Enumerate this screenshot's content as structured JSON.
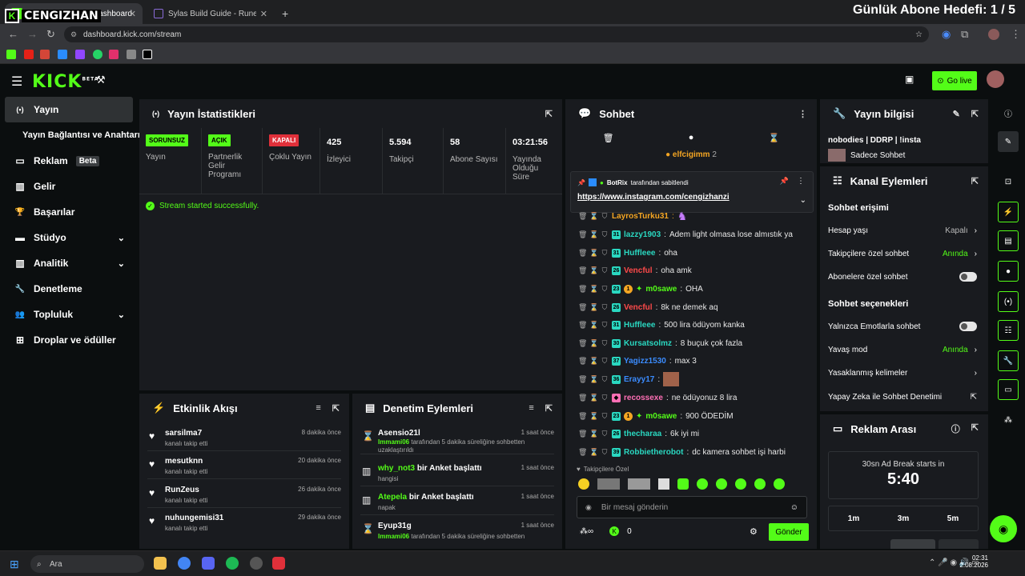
{
  "browser": {
    "tabs": [
      {
        "label": "Dashboard",
        "active": true
      },
      {
        "label": "Sylas Build Guide - Runes, Items",
        "active": false
      }
    ],
    "new_tab": "+",
    "url": "dashboard.kick.com/stream"
  },
  "overlay": {
    "logo_letter": "K",
    "channel_name": "CENGIZHAN",
    "goal_text": "Günlük Abone Hedefi: 1 / 5"
  },
  "header": {
    "logo": "KICK",
    "logo_sup": "BETA",
    "go_live_label": "Go live"
  },
  "sidebar": {
    "items": [
      {
        "label": "Yayın",
        "icon": "broadcast-icon",
        "glyph": "(•)",
        "active": true
      },
      {
        "label": "Yayın Bağlantısı ve Anahtarı",
        "icon": "",
        "glyph": ""
      },
      {
        "label": "Reklam",
        "icon": "monitor-icon",
        "glyph": "▭",
        "badge": "Beta"
      },
      {
        "label": "Gelir",
        "icon": "chart-icon",
        "glyph": "▥"
      },
      {
        "label": "Başarılar",
        "icon": "trophy-icon",
        "glyph": "🏆"
      },
      {
        "label": "Stüdyo",
        "icon": "studio-icon",
        "glyph": "▬",
        "chevron": true
      },
      {
        "label": "Analitik",
        "icon": "analytics-icon",
        "glyph": "▥",
        "chevron": true
      },
      {
        "label": "Denetleme",
        "icon": "wrench-icon",
        "glyph": "🔧"
      },
      {
        "label": "Topluluk",
        "icon": "community-icon",
        "glyph": "👥",
        "chevron": true
      },
      {
        "label": "Droplar ve ödüller",
        "icon": "gift-icon",
        "glyph": "⊞"
      }
    ]
  },
  "stats": {
    "title": "Yayın İstatistikleri",
    "columns": [
      {
        "pill": "SORUNSUZ",
        "pill_color": "#53fc18",
        "label": "Yayın"
      },
      {
        "pill": "AÇIK",
        "pill_color": "#53fc18",
        "label": "Partnerlik Gelir Programı"
      },
      {
        "pill": "KAPALI",
        "pill_color": "#e0303a",
        "label": "Çoklu Yayın"
      },
      {
        "value": "425",
        "label": "İzleyici"
      },
      {
        "value": "5.594",
        "label": "Takipçi"
      },
      {
        "value": "58",
        "label": "Abone Sayısı"
      },
      {
        "value": "03:21:56",
        "label": "Yayında Olduğu Süre"
      }
    ],
    "status_message": "Stream started successfully."
  },
  "activity": {
    "title": "Etkinlik Akışı",
    "items": [
      {
        "name": "sarsilma7",
        "sub": "kanalı takip etti",
        "time": "8 dakika önce"
      },
      {
        "name": "mesutknn",
        "sub": "kanalı takip etti",
        "time": "20 dakika önce"
      },
      {
        "name": "RunZeus",
        "sub": "kanalı takip etti",
        "time": "26 dakika önce"
      },
      {
        "name": "nuhungemisi31",
        "sub": "kanalı takip etti",
        "time": "29 dakika önce"
      }
    ]
  },
  "moderation": {
    "title": "Denetim Eylemleri",
    "items": [
      {
        "name": "Asensio21l",
        "name_color": "#ffffff",
        "action": "",
        "mod": "Immami06",
        "sub": "tarafından 5 dakika süreliğine sohbetten uzaklaştırıldı",
        "time": "1 saat önce",
        "icon": "hourglass-icon",
        "glyph": "⌛"
      },
      {
        "name": "why_not3",
        "name_color": "#53fc18",
        "action": "bir Anket başlattı",
        "mod": "",
        "sub": "hangisi",
        "time": "1 saat önce",
        "icon": "poll-icon",
        "glyph": "▥"
      },
      {
        "name": "Atepela",
        "name_color": "#53fc18",
        "action": "bir Anket başlattı",
        "mod": "",
        "sub": "napak",
        "time": "1 saat önce",
        "icon": "poll-icon",
        "glyph": "▥"
      },
      {
        "name": "Eyup31g",
        "name_color": "#ffffff",
        "action": "",
        "mod": "Immami06",
        "sub": "tarafından 5 dakika süreliğine sohbetten",
        "time": "1 saat önce",
        "icon": "hourglass-icon",
        "glyph": "⌛"
      }
    ]
  },
  "chat": {
    "title": "Sohbet",
    "top_user": "elfcigimm",
    "top_count": "2",
    "pinned": {
      "bot": "BotRix",
      "by_text": "tarafından sabitlendi",
      "link": "https://www.instagram.com/cengizhanzi"
    },
    "messages": [
      {
        "user": "LayrosTurku31",
        "color": "#f5a623",
        "text": ""
      },
      {
        "user": "lazzy1903",
        "color": "#2ad8c1",
        "text": "Adem light olmasa lose almıstık ya"
      },
      {
        "user": "Huffleee",
        "color": "#2ad8c1",
        "text": "oha"
      },
      {
        "user": "Vencful",
        "color": "#ff4a4a",
        "text": "oha amk"
      },
      {
        "user": "m0sawe",
        "color": "#53fc18",
        "text": "OHA"
      },
      {
        "user": "Vencful",
        "color": "#ff4a4a",
        "text": "8k ne demek aq"
      },
      {
        "user": "Huffleee",
        "color": "#2ad8c1",
        "text": "500 lira ödüyom kanka"
      },
      {
        "user": "Kursatsolmz",
        "color": "#2ad8c1",
        "text": "8 buçuk çok fazla"
      },
      {
        "user": "Yagizz1530",
        "color": "#3b8cff",
        "text": "max 3"
      },
      {
        "user": "Erayy17",
        "color": "#3b8cff",
        "text": ""
      },
      {
        "user": "recossexe",
        "color": "#ff6fb5",
        "text": "ne ödüyonuz 8 lira"
      },
      {
        "user": "m0sawe",
        "color": "#53fc18",
        "text": "900 ÖDEDİM"
      },
      {
        "user": "thecharaa",
        "color": "#2ad8c1",
        "text": "6k iyi mi"
      },
      {
        "user": "Robbietherobot",
        "color": "#2ad8c1",
        "text": "dc kamera sohbet işi harbi"
      }
    ],
    "followers_only_label": "Takipçilere Özel",
    "input_placeholder": "Bir mesaj gönderin",
    "points": "0",
    "send_label": "Gönder"
  },
  "stream_info": {
    "title": "Yayın bilgisi",
    "stream_title": "nobodies | DDRP | !insta",
    "category": "Sadece Sohbet"
  },
  "channel_actions": {
    "title": "Kanal Eylemleri",
    "access_header": "Sohbet erişimi",
    "access_rows": [
      {
        "label": "Hesap yaşı",
        "value": "Kapalı",
        "value_color": "#b8b8b8",
        "type": "chevron"
      },
      {
        "label": "Takipçilere özel sohbet",
        "value": "Anında",
        "value_color": "#53fc18",
        "type": "chevron"
      },
      {
        "label": "Abonelere özel sohbet",
        "value": "",
        "type": "toggle"
      }
    ],
    "options_header": "Sohbet seçenekleri",
    "option_rows": [
      {
        "label": "Yalnızca Emotlarla sohbet",
        "value": "",
        "type": "toggle"
      },
      {
        "label": "Yavaş mod",
        "value": "Anında",
        "value_color": "#53fc18",
        "type": "chevron"
      },
      {
        "label": "Yasaklanmış kelimeler",
        "value": "",
        "type": "chevron"
      },
      {
        "label": "Yapay Zeka ile Sohbet Denetimi",
        "value": "",
        "type": "external"
      }
    ]
  },
  "ad_break": {
    "title": "Reklam Arası",
    "caption": "30sn Ad Break starts in",
    "countdown": "5:40",
    "options": [
      "1m",
      "3m",
      "5m"
    ]
  },
  "taskbar": {
    "search_placeholder": "Ara",
    "time": "02:31",
    "date": "2.08.2026"
  },
  "colors": {
    "accent": "#53fc18",
    "panel": "#191b1f",
    "background": "#0b0e0f"
  }
}
